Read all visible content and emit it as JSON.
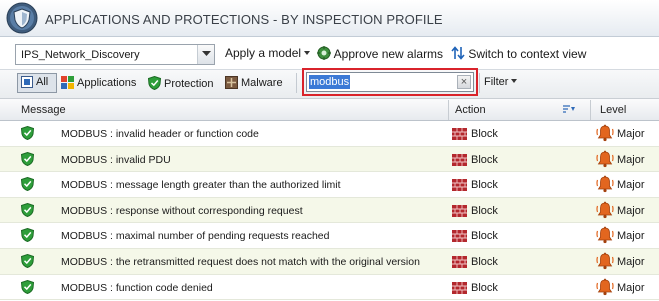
{
  "window": {
    "title": "APPLICATIONS AND PROTECTIONS - BY INSPECTION PROFILE"
  },
  "toolbar": {
    "profile": "IPS_Network_Discovery",
    "apply_model": "Apply a model",
    "approve_alarms": "Approve new alarms",
    "switch_context": "Switch to context view"
  },
  "filters": {
    "all": "All",
    "applications": "Applications",
    "protection": "Protection",
    "malware": "Malware",
    "search_value": "modbus",
    "filter": "Filter"
  },
  "table": {
    "columns": {
      "message": "Message",
      "action": "Action",
      "level": "Level"
    },
    "rows": [
      {
        "message": "MODBUS : invalid header or function code",
        "action": "Block",
        "level": "Major"
      },
      {
        "message": "MODBUS : invalid PDU",
        "action": "Block",
        "level": "Major"
      },
      {
        "message": "MODBUS : message length greater than the authorized limit",
        "action": "Block",
        "level": "Major"
      },
      {
        "message": "MODBUS : response without corresponding request",
        "action": "Block",
        "level": "Major"
      },
      {
        "message": "MODBUS : maximal number of pending requests reached",
        "action": "Block",
        "level": "Major"
      },
      {
        "message": "MODBUS : the retransmitted request does not match with the original version",
        "action": "Block",
        "level": "Major"
      },
      {
        "message": "MODBUS : function code denied",
        "action": "Block",
        "level": "Major"
      }
    ]
  },
  "colors": {
    "accent_red": "#d9232b",
    "shield_green": "#2e9e3a",
    "block_red": "#b3282d",
    "selection_blue": "#3b79d6"
  }
}
